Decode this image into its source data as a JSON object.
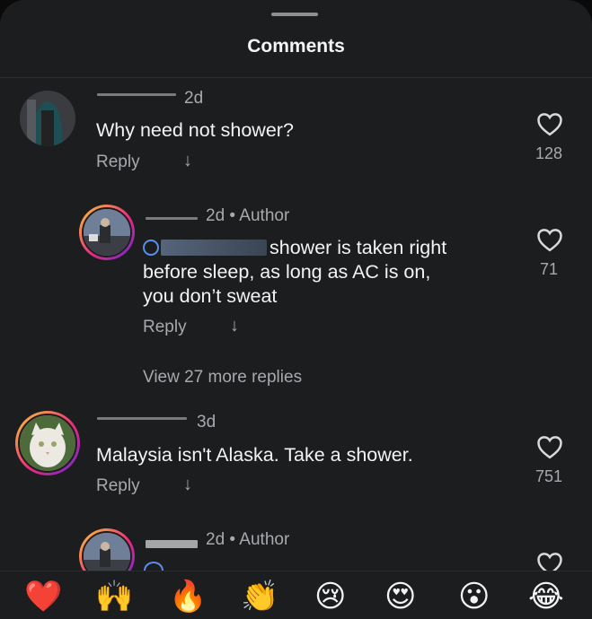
{
  "header": {
    "title": "Comments"
  },
  "comments": [
    {
      "time": "2d",
      "text": "Why need not shower?",
      "reply": "Reply",
      "likes": "128"
    },
    {
      "time": "2d • Author",
      "text_after_mention": "shower is taken right",
      "text_line2": "before sleep, as long as AC is on,",
      "text_line3": "you don’t sweat",
      "reply": "Reply",
      "likes": "71"
    },
    {
      "view_more": "View 27 more replies"
    },
    {
      "time": "3d",
      "text": "Malaysia isn't Alaska. Take a shower.",
      "reply": "Reply",
      "likes": "751"
    },
    {
      "time": "2d • Author"
    }
  ],
  "reactions": [
    {
      "icon": "red-heart",
      "glyph": "❤️"
    },
    {
      "icon": "raising-hands",
      "glyph": "🙌"
    },
    {
      "icon": "fire",
      "glyph": "🔥"
    },
    {
      "icon": "clapping-hands",
      "glyph": "👏"
    },
    {
      "icon": "crying-face",
      "glyph": "😢"
    },
    {
      "icon": "heart-eyes-face",
      "glyph": "😍"
    },
    {
      "icon": "surprised-face",
      "glyph": "😮"
    },
    {
      "icon": "tears-of-joy-face",
      "glyph": "😂"
    }
  ],
  "colors": {
    "background": "#1c1d1f",
    "text": "#f2f3f5",
    "secondary": "#a8a9ad",
    "mention": "#5a8dee"
  }
}
